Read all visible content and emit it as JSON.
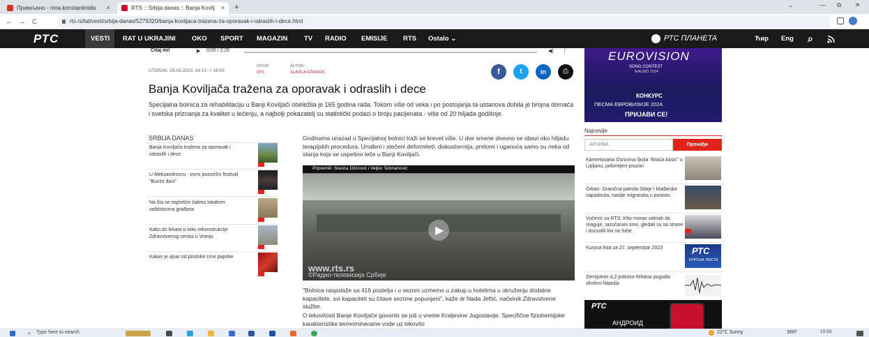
{
  "browser": {
    "tabs": [
      {
        "title": "Примљено - nina.konstantinidis ",
        "close": "×",
        "active": false
      },
      {
        "title": "RTS :: Srbija danas :: Banja Kovilj",
        "close": "×",
        "active": true
      }
    ],
    "new_tab": "+",
    "window_controls": [
      "⌄",
      "—",
      "⧉",
      "✕"
    ],
    "nav": {
      "back": "←",
      "forward": "→",
      "reload": "C"
    },
    "url": "rts.rs/lat/vesti/srbija-danas/5279320/banja-koviljaca-trazena-za-oporavak-i-odraslih-i-dece.html"
  },
  "site_nav": {
    "logo": "РТС",
    "items": [
      "VESTI",
      "RAT U UKRAJINI",
      "OKO",
      "SPORT",
      "MAGAZIN",
      "TV",
      "RADIO",
      "EMISIJE",
      "RTS",
      "Ostalo ⌄"
    ],
    "planeta": "РТС ПЛАНЕТА",
    "lang1": "Ћир",
    "lang2": "Eng",
    "search_icon": "⌕",
    "rss_icon": "rss"
  },
  "audio": {
    "label": "Čitaj mi!",
    "time": "0:00 / 2:26"
  },
  "article": {
    "date": "UTORAK, 26.09.2023. 14:19 -> 16:03",
    "source_label": "IZVOR:",
    "source": "RTS",
    "author_label": "AUTOR:",
    "author": "SLAVICA DŽINOVIĆ",
    "title": "Banja Koviljača tražena za oporavak i odraslih i dece",
    "lead": "Specijalna bolnica za rehabilitaciju u Banji Koviljači obeležila je 165 godina rada. Tokom više od veka i po postojanja ta ustanova dobila je brojna domaća i svetska priznanja za kvalitet u lečenju, a najbolji pokazatelj su statistički podaci o broju pacijenata - više od 20 hiljada godišnje.",
    "body1": "Godinama unazad u Specijalnoj bolnici traži se krevet više. U dve smene dnevno se obavi oko hiljadu terapijskih procedura. Urođeni i stečeni deformiteti, diskushernija, prelomi i uganuća samo su neka od stanja koja se uspešno leče u Banji Koviljači.",
    "video_caption": "Pripremili: Slavica Džinović i Veljko Tešmanović",
    "watermark1": "www.rts.rs",
    "watermark2": "©Радио-телевизија Србије",
    "body2": "\"Bolnica raspolaže sa 416 postelja i u sezoni uzmemo u zakup u hotelima u okruženju dodatne kapacitete, svi kapaciteti su čitave sezone popunjeni\", kaže dr Nada Jeftić, načelnik Zdravstvene službe.",
    "body3": "O lekovitosti Banje Koviljače govorilo se još u vreme Kraljevine Jugoslavije. Specifične fiziohemijske karakteristike termomineralne vode uz lekovito"
  },
  "share": [
    "f",
    "t",
    "in",
    "⎙"
  ],
  "sidebar": {
    "heading": "SRBIJA DANAS",
    "items": [
      {
        "label": "Banja Koviljača tražena za oporavak i odraslih i dece"
      },
      {
        "label": "U Aleksandrovcu - osmi pozorišni festival \"Bucini dani\""
      },
      {
        "label": "Na šta se najčešće žalimo lokalnim zaštitnicima građana"
      },
      {
        "label": "Kako do lekara u toku rekonstrukcije Zdravstvenog centra u Vranju"
      },
      {
        "label": "Kakav je ajvar od pirotske crne paprike"
      }
    ]
  },
  "banner": {
    "logo": "EUROVISION",
    "sub1": "SONG CONTEST",
    "sub2": "MALMÖ 2024",
    "line1": "КОНКУРС",
    "line2": "ПЕСМА ЕВРОВИЗИЈЕ 2024.",
    "cta": "ПРИЈАВИ СЕ!"
  },
  "right": {
    "heading": "Najnovije",
    "search_placeholder": "АРХИВА",
    "search_button": "Пронађи",
    "items": [
      {
        "label": "Kamenovana Osnovna škola \"Braća Aksić\" u Lipljanu, polomljeni prozori"
      },
      {
        "label": "Orban: Granična patrola Srbije i Mađarske napadnuta, nasilje migranata u porastu"
      },
      {
        "label": "Vučević za RTS: Kfor morao odmah da reaguje, razočarani smo, gledali su sa strane i dozvolili lov na Srbe"
      },
      {
        "label": "Kursna lista za 27. septembar 2023"
      },
      {
        "label": "Zemljotres 4,2 jedinice Rihtera pogodio okolinu Napulja"
      }
    ],
    "kurs_logo": "РТС",
    "kurs_text": "КУРСНА ЛИСТА",
    "app_logo": "РТС",
    "app_text": "АНДРОИД"
  },
  "taskbar": {
    "search": "Type here to search",
    "weather": "22°C Sunny",
    "lang": "SRP",
    "time": "10:33"
  },
  "colors": {
    "brand_red": "#e1251b",
    "nav_bg": "#1a1a1a",
    "euro_bg": "#2a1a7a"
  }
}
